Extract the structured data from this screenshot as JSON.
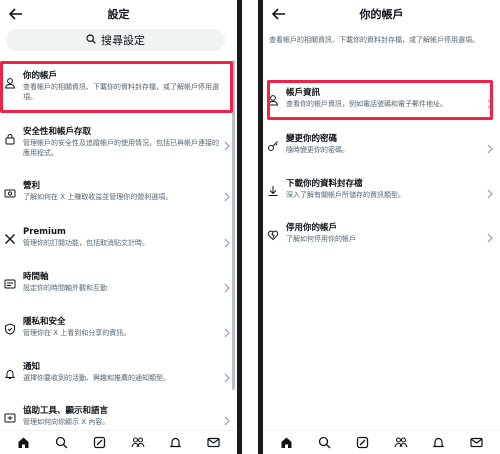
{
  "left": {
    "title": "設定",
    "search_label": "搜尋設定",
    "items": [
      {
        "title": "你的帳戶",
        "desc": "查看帳戶的相關資訊、下載你的資料封存檔，或了解帳戶停用選項。",
        "icon": "person-icon"
      },
      {
        "title": "安全性和帳戶存取",
        "desc": "管理帳戶的安全性及追蹤帳戶的使用情況，包括已與帳戶連接的應用程式。",
        "icon": "lock-icon"
      },
      {
        "title": "營利",
        "desc": "了解如何在 X 上賺取收益並管理你的營利選項。",
        "icon": "money-icon"
      },
      {
        "title": "Premium",
        "desc": "管理你的訂閱功能，包括取消贴文計時。",
        "icon": "x-logo-icon"
      },
      {
        "title": "時間軸",
        "desc": "設定你的時間軸外觀和互動",
        "icon": "timeline-icon"
      },
      {
        "title": "隱私和安全",
        "desc": "管理你在 X 上看到和分享的資訊。",
        "icon": "shield-icon"
      },
      {
        "title": "通知",
        "desc": "選擇你要收到的活動、興趣和推薦的通知類型。",
        "icon": "bell-icon"
      },
      {
        "title": "協助工具、顯示和語言",
        "desc": "管理如何向你顯示 X 內容。",
        "icon": "accessibility-icon"
      }
    ]
  },
  "right": {
    "title": "你的帳戶",
    "intro": "查看帳戶的相關資訊、下載你的資料封存檔，或了解帳戶停用選項。",
    "items": [
      {
        "title": "帳戶資訊",
        "desc": "查看你的帳戶資訊，例如電話號碼和電子郵件地址。",
        "icon": "person-icon"
      },
      {
        "title": "變更你的密碼",
        "desc": "隨時變更你的密碼。",
        "icon": "key-icon"
      },
      {
        "title": "下載你的資料封存檔",
        "desc": "深入了解有關帳戶所儲存的資訊類型。",
        "icon": "download-icon"
      },
      {
        "title": "停用你的帳戶",
        "desc": "了解如何停用你的帳戶",
        "icon": "broken-heart-icon"
      }
    ]
  },
  "nav": [
    "home-icon",
    "search-icon",
    "grok-icon",
    "communities-icon",
    "notifications-icon",
    "messages-icon"
  ]
}
